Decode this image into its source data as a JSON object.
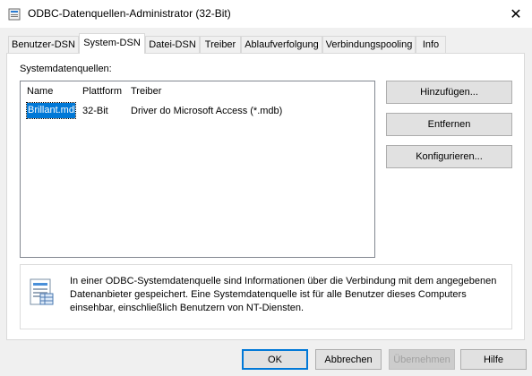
{
  "window": {
    "title": "ODBC-Datenquellen-Administrator (32-Bit)",
    "close": "✕"
  },
  "tabs": [
    {
      "label": "Benutzer-DSN"
    },
    {
      "label": "System-DSN",
      "active": true
    },
    {
      "label": "Datei-DSN"
    },
    {
      "label": "Treiber"
    },
    {
      "label": "Ablaufverfolgung"
    },
    {
      "label": "Verbindungspooling"
    },
    {
      "label": "Info"
    }
  ],
  "group_label": "Systemdatenquellen:",
  "list": {
    "columns": [
      "Name",
      "Plattform",
      "Treiber"
    ],
    "rows": [
      {
        "name": "Brillant.mdb",
        "platform": "32-Bit",
        "driver": "Driver do Microsoft Access (*.mdb)"
      }
    ]
  },
  "side_buttons": {
    "add": "Hinzufügen...",
    "remove": "Entfernen",
    "configure": "Konfigurieren..."
  },
  "info": {
    "text": "In einer ODBC-Systemdatenquelle sind Informationen über die Verbindung mit dem angegebenen Datenanbieter gespeichert. Eine Systemdatenquelle ist für alle Benutzer dieses Computers einsehbar, einschließlich Benutzern von NT-Diensten.",
    "icon": "datasource-icon"
  },
  "footer": {
    "ok": "OK",
    "cancel": "Abbrechen",
    "apply": "Übernehmen",
    "help": "Hilfe"
  },
  "colors": {
    "accent": "#0078d7"
  }
}
